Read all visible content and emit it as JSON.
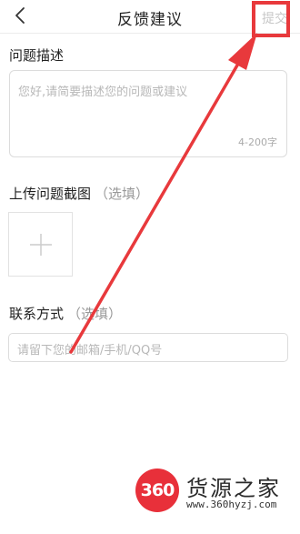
{
  "header": {
    "title": "反馈建议",
    "back_icon": "chevron-left-icon",
    "submit_label": "提交"
  },
  "problem": {
    "title": "问题描述",
    "placeholder": "您好,请简要描述您的问题或建议",
    "char_limit": "4-200字"
  },
  "screenshot": {
    "title": "上传问题截图",
    "optional": "（选填）",
    "add_icon": "plus-icon"
  },
  "contact": {
    "title": "联系方式",
    "optional": "（选填）",
    "placeholder": "请留下您的邮箱/手机/QQ号"
  },
  "annotation": {
    "highlight_color": "#e8393c",
    "arrow_color": "#e8393c"
  },
  "watermark": {
    "badge": "360",
    "name": "货源之家",
    "url": "www.360hyzj.com"
  },
  "colors": {
    "placeholder": "#b8b8b8",
    "submit_disabled": "#c7c7c7",
    "brand_red": "#e8303a"
  }
}
